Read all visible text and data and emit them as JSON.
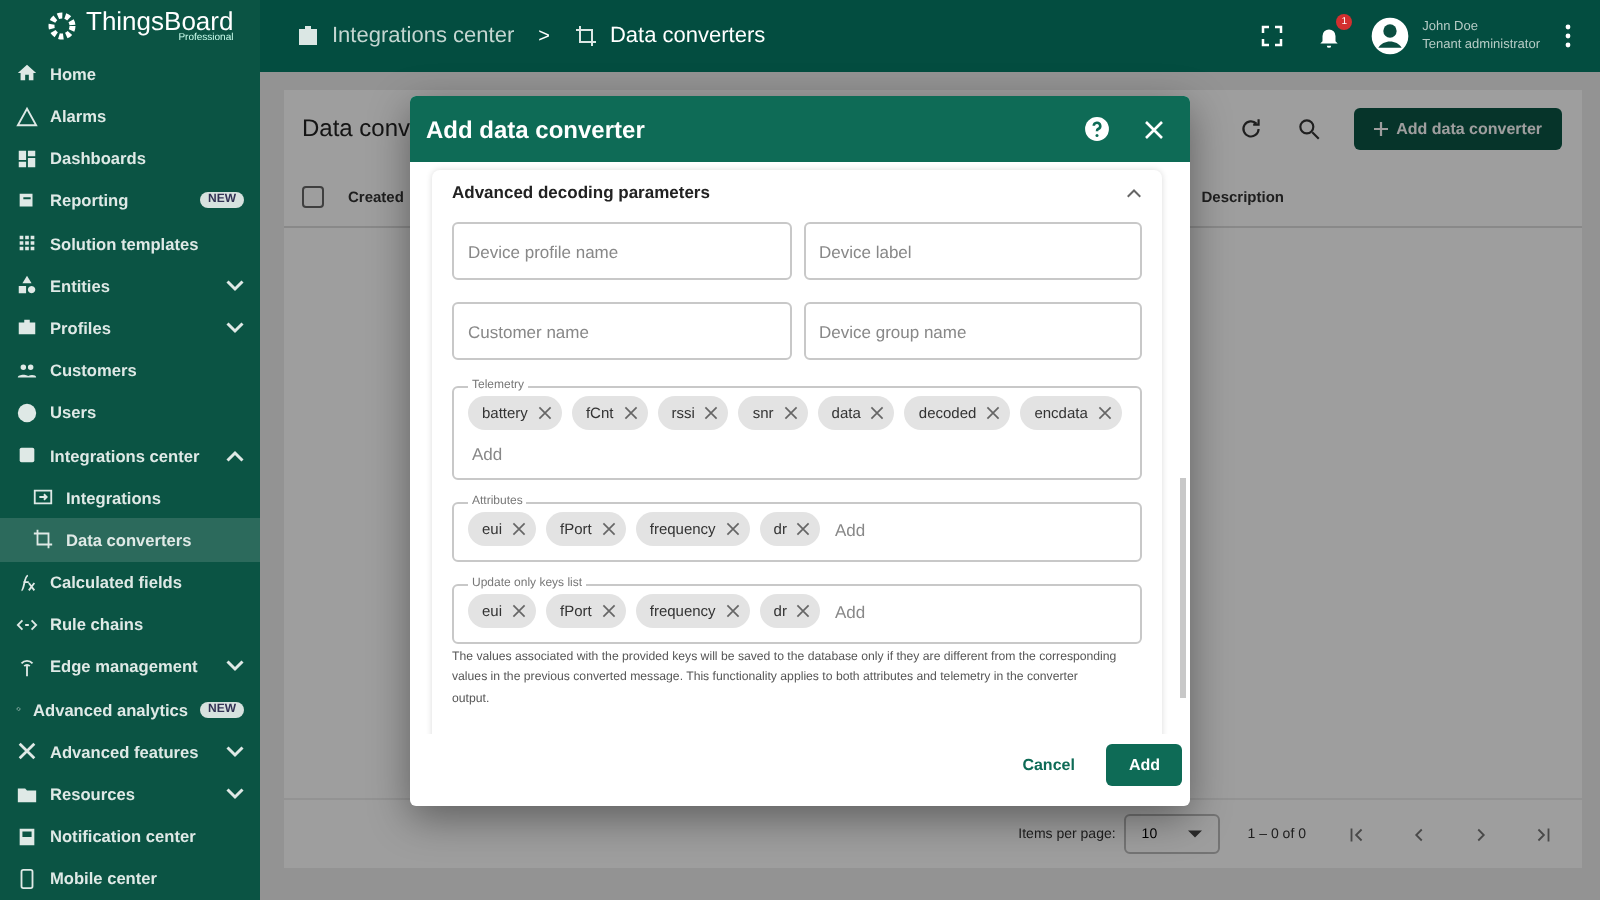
{
  "brand": {
    "name": "ThingsBoard",
    "edition": "Professional"
  },
  "sidebar": {
    "items": [
      {
        "label": "Home",
        "kind": "link",
        "selected": false
      },
      {
        "label": "Alarms",
        "kind": "link",
        "selected": false
      },
      {
        "label": "Dashboards",
        "kind": "link",
        "selected": false
      },
      {
        "label": "Reporting",
        "kind": "link",
        "selected": false,
        "badge": "NEW"
      },
      {
        "label": "Solution templates",
        "kind": "link",
        "selected": false
      },
      {
        "label": "Entities",
        "kind": "group",
        "selected": false,
        "expanded": false
      },
      {
        "label": "Profiles",
        "kind": "group",
        "selected": false,
        "expanded": false
      },
      {
        "label": "Customers",
        "kind": "link",
        "selected": false
      },
      {
        "label": "Users",
        "kind": "link",
        "selected": false
      },
      {
        "label": "Integrations center",
        "kind": "group",
        "selected": false,
        "expanded": true,
        "children": [
          {
            "label": "Integrations",
            "selected": false
          },
          {
            "label": "Data converters",
            "selected": true
          }
        ]
      },
      {
        "label": "Calculated fields",
        "kind": "link",
        "selected": false
      },
      {
        "label": "Rule chains",
        "kind": "link",
        "selected": false
      },
      {
        "label": "Edge management",
        "kind": "group",
        "selected": false,
        "expanded": false
      },
      {
        "label": "Advanced analytics",
        "kind": "link",
        "selected": false,
        "badge": "NEW"
      },
      {
        "label": "Advanced features",
        "kind": "group",
        "selected": false,
        "expanded": false
      },
      {
        "label": "Resources",
        "kind": "group",
        "selected": false,
        "expanded": false
      },
      {
        "label": "Notification center",
        "kind": "link",
        "selected": false
      },
      {
        "label": "Mobile center",
        "kind": "link",
        "selected": false
      }
    ]
  },
  "top_bar": {
    "breadcrumbs": [
      "Integrations center",
      "Data converters"
    ],
    "separator": ">",
    "notification_count": "1",
    "user": {
      "name": "John Doe",
      "role": "Tenant administrator"
    }
  },
  "page": {
    "title": "Data conv",
    "add_button": "Add data converter",
    "table": {
      "select_all_checked": false,
      "columns": [
        "Created",
        "Description"
      ]
    },
    "pagination": {
      "items_per_page_label": "Items per page:",
      "items_per_page": "10",
      "range": "1 – 0 of 0"
    }
  },
  "dialog": {
    "title": "Add data converter",
    "section": {
      "title": "Advanced decoding parameters",
      "expanded": true,
      "fields": [
        {
          "placeholder": "Device profile name"
        },
        {
          "placeholder": "Device label"
        },
        {
          "placeholder": "Customer name"
        },
        {
          "placeholder": "Device group name"
        }
      ],
      "chip_lists": [
        {
          "label": "Telemetry",
          "chips": [
            "battery",
            "fCnt",
            "rssi",
            "snr",
            "data",
            "decoded",
            "encdata"
          ],
          "placeholder": "Add"
        },
        {
          "label": "Attributes",
          "chips": [
            "eui",
            "fPort",
            "frequency",
            "dr"
          ],
          "placeholder": "Add"
        },
        {
          "label": "Update only keys list",
          "chips": [
            "eui",
            "fPort",
            "frequency",
            "dr"
          ],
          "placeholder": "Add"
        }
      ],
      "hint": " The values associated with the provided keys will be saved to the database only if they are different from the corresponding values in the previous converted message. This functionality applies to both attributes and telemetry in the converter output."
    },
    "buttons": {
      "cancel": "Cancel",
      "confirm": "Add"
    }
  }
}
